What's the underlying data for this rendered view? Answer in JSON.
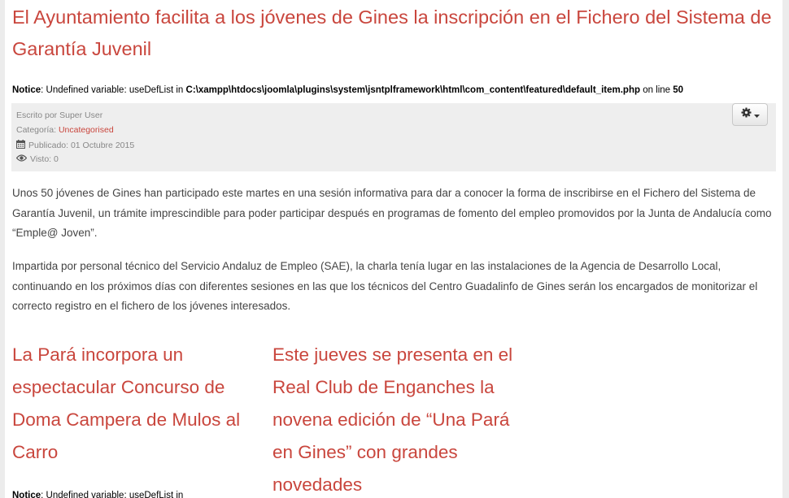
{
  "article": {
    "title": "El Ayuntamiento facilita a los jóvenes de Gines la inscripción en el Fichero del Sistema de Garantía Juvenil",
    "notice": {
      "label": "Notice",
      "text_before": ": Undefined variable: useDefList in ",
      "path": "C:\\xampp\\htdocs\\joomla\\plugins\\system\\jsntplframework\\html\\com_content\\featured\\default_item.php",
      "text_mid": " on line ",
      "line": "50"
    },
    "meta": {
      "author": "Escrito por Super User",
      "category_label": "Categoría: ",
      "category_value": "Uncategorised",
      "published": "Publicado: 01 Octubre 2015",
      "views": "Visto: 0"
    },
    "paragraphs": [
      "Unos 50 jóvenes de Gines han participado este martes en una sesión informativa para dar a conocer la forma de inscribirse en el Fichero del Sistema de Garantía Juvenil, un trámite imprescindible para poder participar después en programas de fomento del empleo promovidos por la Junta de Andalucía como “Emple@ Joven”.",
      "Impartida por personal técnico del Servicio Andaluz de Empleo (SAE), la charla tenía lugar en las instalaciones de la Agencia de Desarrollo Local, continuando en los próximos días con diferentes sesiones en las que los técnicos del Centro Guadalinfo de Gines serán los encargados de monitorizar el correcto registro en el fichero de los jóvenes interesados."
    ]
  },
  "columns": [
    {
      "title": "La Pará incorpora un espectacular Concurso de Doma Campera de Mulos al Carro",
      "notice_label": "Notice",
      "notice_text": ": Undefined variable: useDefList in"
    },
    {
      "title": "Este jueves se presenta en el Real Club de Enganches la novena edición de “Una Pará en Gines” con grandes novedades"
    }
  ],
  "icons": {
    "gear": "gear-icon",
    "caret": "caret-down-icon",
    "calendar": "calendar-icon",
    "eye": "eye-icon"
  },
  "colors": {
    "accent": "#c9463d",
    "meta_bg": "#eeeeee",
    "body_text": "#444444",
    "page_bg": "#ececec"
  }
}
